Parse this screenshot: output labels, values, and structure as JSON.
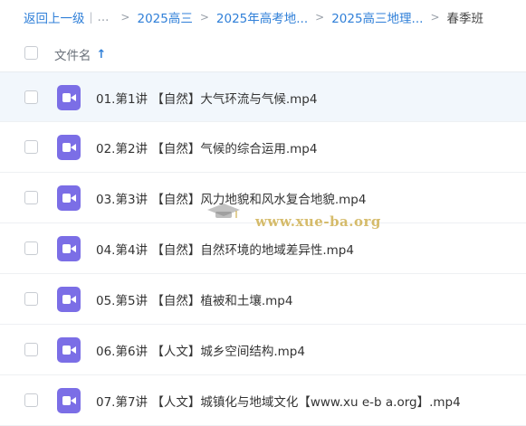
{
  "breadcrumb": {
    "back": "返回上一级",
    "ellipsis": "...",
    "items": [
      "2025高三",
      "2025年高考地...",
      "2025高三地理..."
    ],
    "current": "春季班"
  },
  "header": {
    "name_label": "文件名",
    "sort_icon": "arrow-up-icon"
  },
  "files": [
    {
      "name": "01.第1讲 【自然】大气环流与气候.mp4"
    },
    {
      "name": "02.第2讲 【自然】气候的综合运用.mp4"
    },
    {
      "name": "03.第3讲 【自然】风力地貌和风水复合地貌.mp4"
    },
    {
      "name": "04.第4讲 【自然】自然环境的地域差异性.mp4"
    },
    {
      "name": "05.第5讲 【自然】植被和土壤.mp4"
    },
    {
      "name": "06.第6讲 【人文】城乡空间结构.mp4"
    },
    {
      "name": "07.第7讲 【人文】城镇化与地域文化【www.xu e-b a.org】.mp4"
    }
  ],
  "watermark": {
    "text": "www.xue-ba.org"
  },
  "colors": {
    "link": "#2f7fd8",
    "video_icon": "#7b6ee6",
    "selected_row": "#f2f7fc"
  }
}
